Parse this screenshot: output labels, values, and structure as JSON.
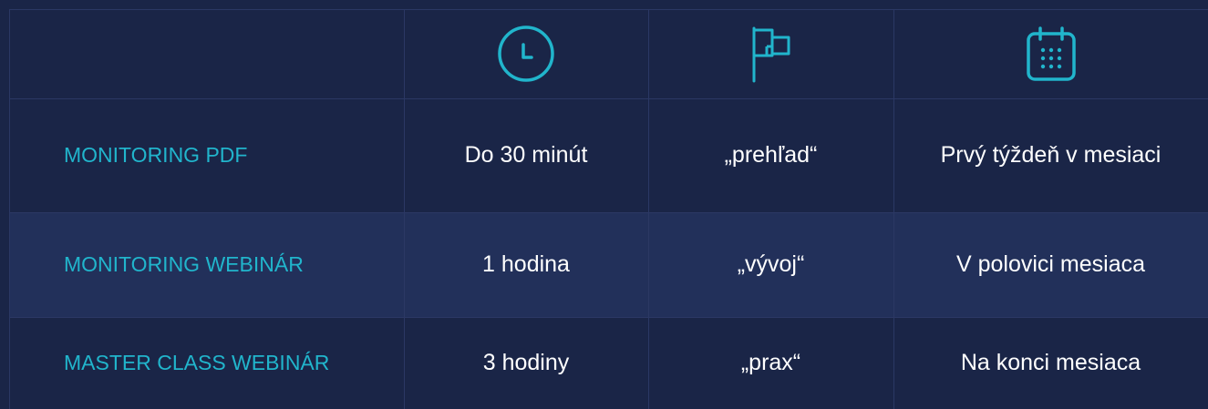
{
  "colors": {
    "background": "#1a2547",
    "row_alt": "#22305a",
    "grid": "#2b3864",
    "accent": "#21b5cc",
    "text": "#ffffff"
  },
  "header": {
    "icons": [
      "clock-icon",
      "flag-icon",
      "calendar-icon"
    ]
  },
  "rows": [
    {
      "name": "MONITORING PDF",
      "duration": "Do 30 minút",
      "focus": "„prehľad“",
      "timing": "Prvý týždeň v mesiaci"
    },
    {
      "name": "MONITORING WEBINÁR",
      "duration": "1 hodina",
      "focus": "„vývoj“",
      "timing": "V polovici mesiaca"
    },
    {
      "name": "MASTER CLASS WEBINÁR",
      "duration": "3 hodiny",
      "focus": "„prax“",
      "timing": "Na konci mesiaca"
    }
  ]
}
